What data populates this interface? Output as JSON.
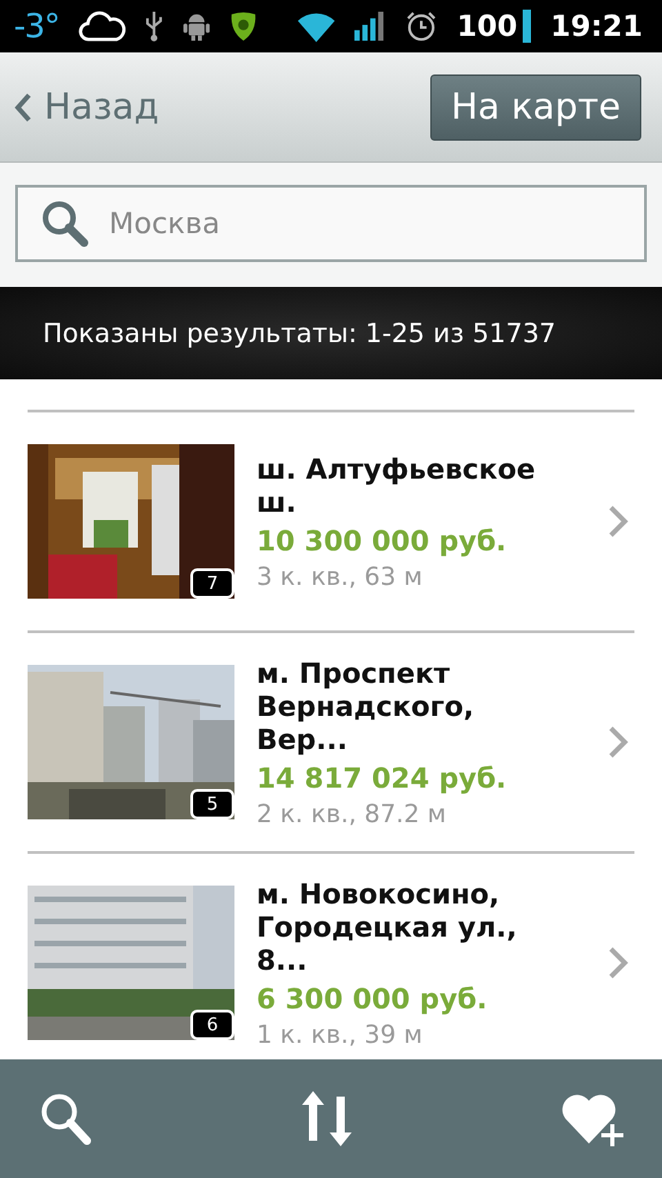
{
  "status_bar": {
    "temperature": "-3°",
    "battery": "100",
    "time": "19:21"
  },
  "header": {
    "back": "Назад",
    "map_button": "На карте"
  },
  "search": {
    "placeholder": "Москва"
  },
  "results": {
    "summary": "Показаны результаты: 1-25 из 51737"
  },
  "listings": [
    {
      "address": "ш. Алтуфьевское ш.",
      "price": "10 300 000 руб.",
      "details": "3 к. кв., 63 м",
      "photos": "7"
    },
    {
      "address": "м. Проспект Вернадского, Вер...",
      "price": "14 817 024 руб.",
      "details": "2 к. кв., 87.2 м",
      "photos": "5"
    },
    {
      "address": "м. Новокосино, Городецкая ул., 8...",
      "price": "6 300 000 руб.",
      "details": "1 к. кв., 39 м",
      "photos": "6"
    }
  ]
}
